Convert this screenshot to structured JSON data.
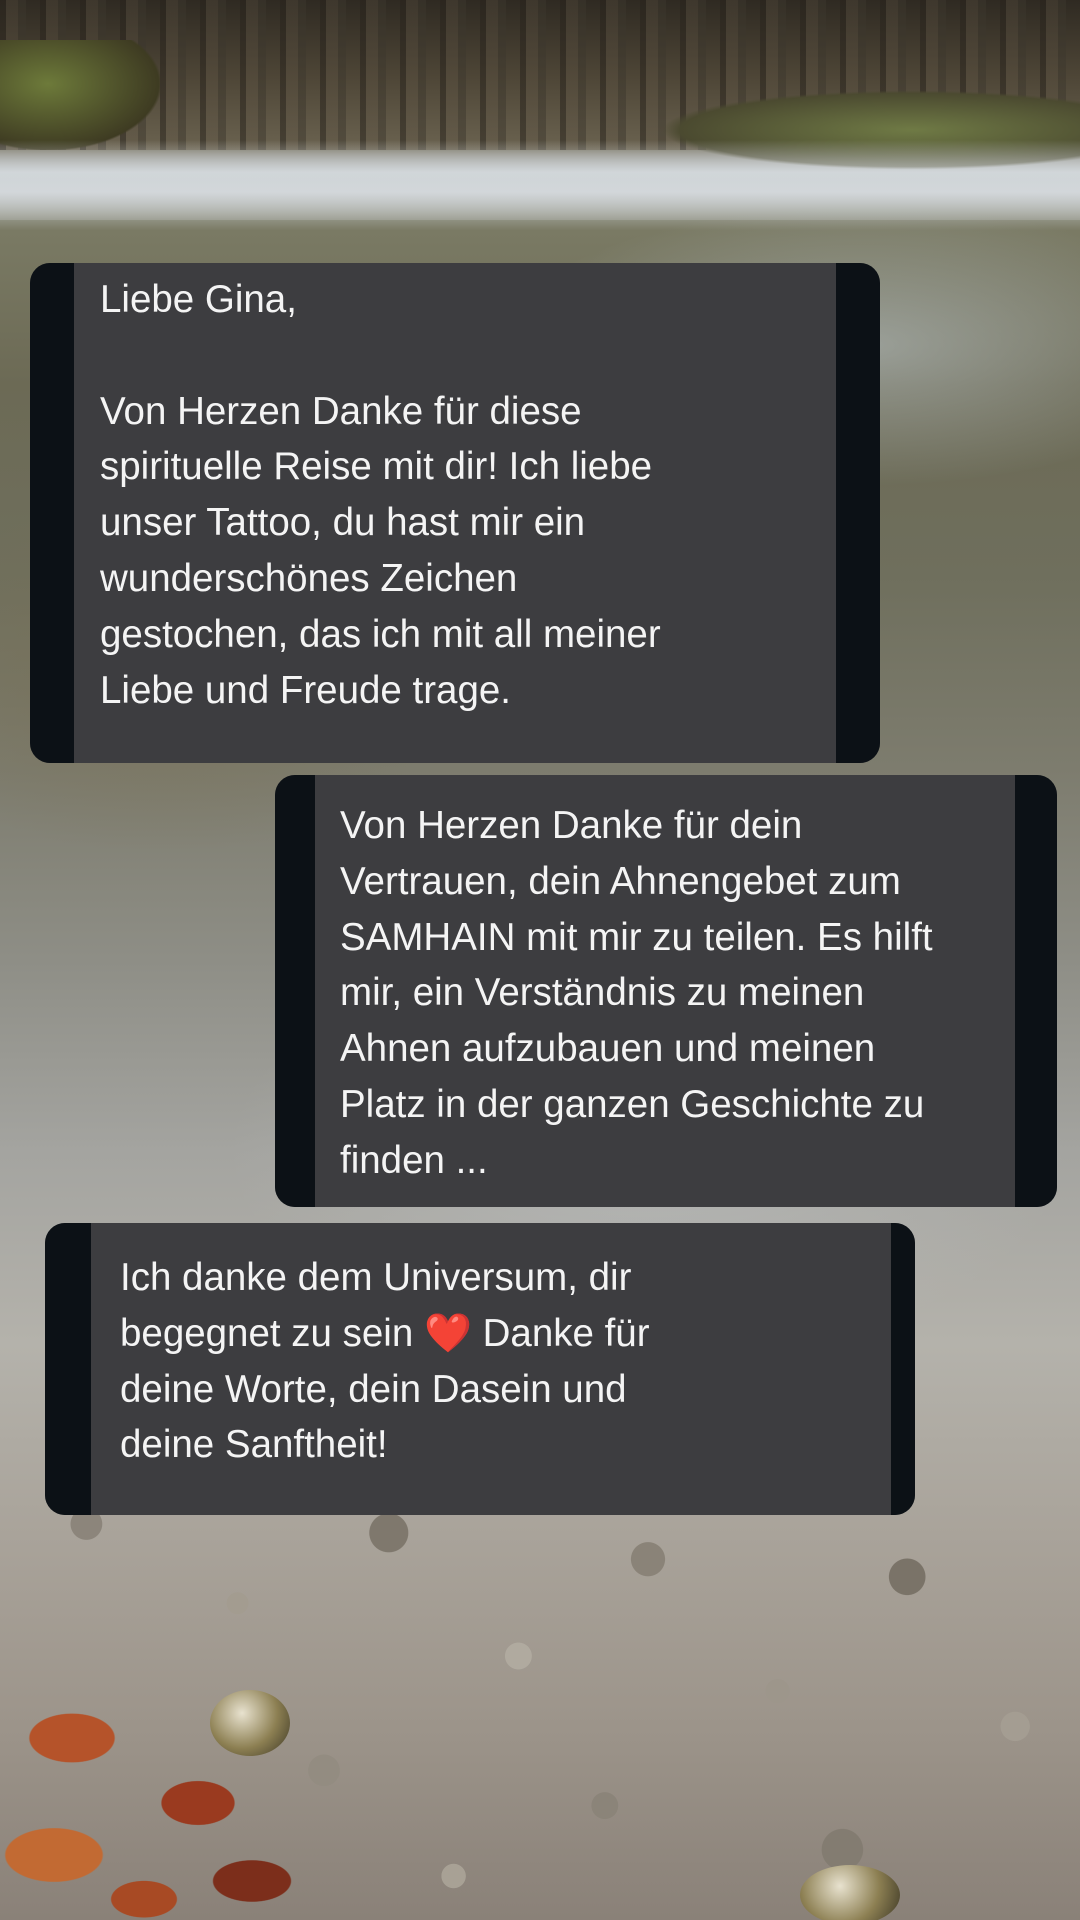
{
  "messages": [
    {
      "id": "m1",
      "side": "left",
      "text": "Liebe Gina,\n\nVon Herzen Danke für diese\nspirituelle Reise mit dir! Ich liebe\nunser Tattoo, du hast mir ein\nwunderschönes Zeichen\ngestochen, das ich mit all meiner\nLiebe und Freude trage."
    },
    {
      "id": "m2",
      "side": "right",
      "text": "Von Herzen Danke für dein\nVertrauen, dein Ahnengebet zum\nSAMHAIN mit mir zu teilen. Es hilft\nmir, ein Verständnis zu meinen\nAhnen aufzubauen und meinen\nPlatz in der ganzen Geschichte zu\nfinden ..."
    },
    {
      "id": "m3",
      "side": "left",
      "text_before": "Ich danke dem Universum, dir\nbegegnet zu sein ",
      "emoji": "❤️",
      "text_after": " Danke für\ndeine Worte, dein Dasein und\ndeine Sanftheit!"
    }
  ],
  "colors": {
    "bubble": "#3d3d40",
    "bubble_edge": "#0c1116",
    "text": "#f4f4f4",
    "heart": "#e0242c"
  },
  "background": {
    "icon": "river-photo"
  }
}
